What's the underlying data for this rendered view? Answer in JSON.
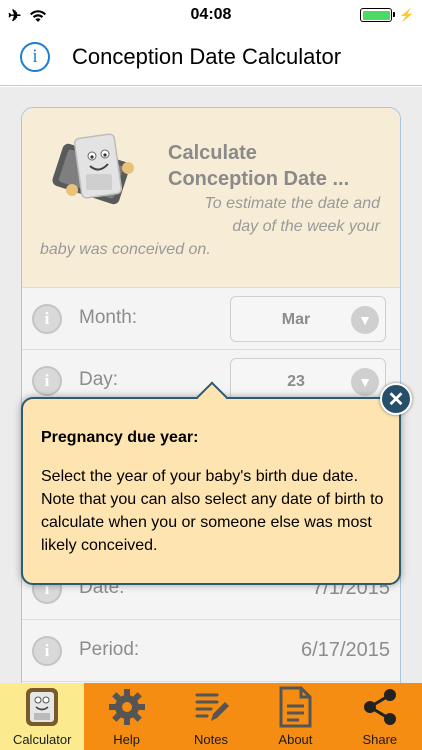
{
  "status_bar": {
    "time": "04:08"
  },
  "nav": {
    "title": "Conception Date Calculator"
  },
  "header": {
    "title_line1": "Calculate",
    "title_line2": "Conception Date ...",
    "subtitle_line1": "To estimate the date and",
    "subtitle_line2": "day of the week your",
    "subtitle_line3": "baby was conceived on."
  },
  "rows": {
    "month": {
      "label": "Month:",
      "value": "Mar"
    },
    "day": {
      "label": "Day:",
      "value": "23"
    },
    "date": {
      "label": "Date:",
      "value": "7/1/2015"
    },
    "period": {
      "label": "Period:",
      "value": "6/17/2015"
    }
  },
  "popover": {
    "title": "Pregnancy due year:",
    "text": "Select the year of your baby's birth due date. Note that you can also select any date of birth to calculate when you or someone else was most likely conceived."
  },
  "tabs": [
    {
      "label": "Calculator",
      "icon": "calculator-icon",
      "active": true
    },
    {
      "label": "Help",
      "icon": "gear-icon"
    },
    {
      "label": "Notes",
      "icon": "notes-icon"
    },
    {
      "label": "About",
      "icon": "document-icon"
    },
    {
      "label": "Share",
      "icon": "share-icon"
    }
  ],
  "colors": {
    "accent_blue": "#1a7fd4",
    "tab_bar": "#f58d12",
    "tab_active": "#fbeb8e",
    "popover_bg": "#fde4b0",
    "popover_border": "#2d5a74"
  }
}
